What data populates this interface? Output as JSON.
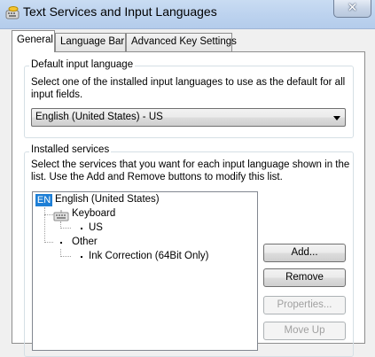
{
  "window": {
    "title": "Text Services and Input Languages",
    "close_glyph": "✕",
    "app_icon": "text-services-icon"
  },
  "tabs": [
    {
      "label": "General",
      "active": true
    },
    {
      "label": "Language Bar",
      "active": false
    },
    {
      "label": "Advanced Key Settings",
      "active": false
    }
  ],
  "default_language": {
    "legend": "Default input language",
    "description": "Select one of the installed input languages to use as the default for all input fields.",
    "selected": "English (United States) - US"
  },
  "installed_services": {
    "legend": "Installed services",
    "description": "Select the services that you want for each input language shown in the list. Use the Add and Remove buttons to modify this list.",
    "tree": {
      "language_badge": "EN",
      "language": "English (United States)",
      "keyboard_label": "Keyboard",
      "keyboard_item": "US",
      "other_label": "Other",
      "other_item": "Ink Correction (64Bit Only)"
    },
    "buttons": {
      "add": "Add...",
      "remove": "Remove",
      "properties": "Properties...",
      "move_up": "Move Up"
    }
  },
  "colors": {
    "badge": "#1e7fd6",
    "titlebar": "#bdd3ef"
  }
}
